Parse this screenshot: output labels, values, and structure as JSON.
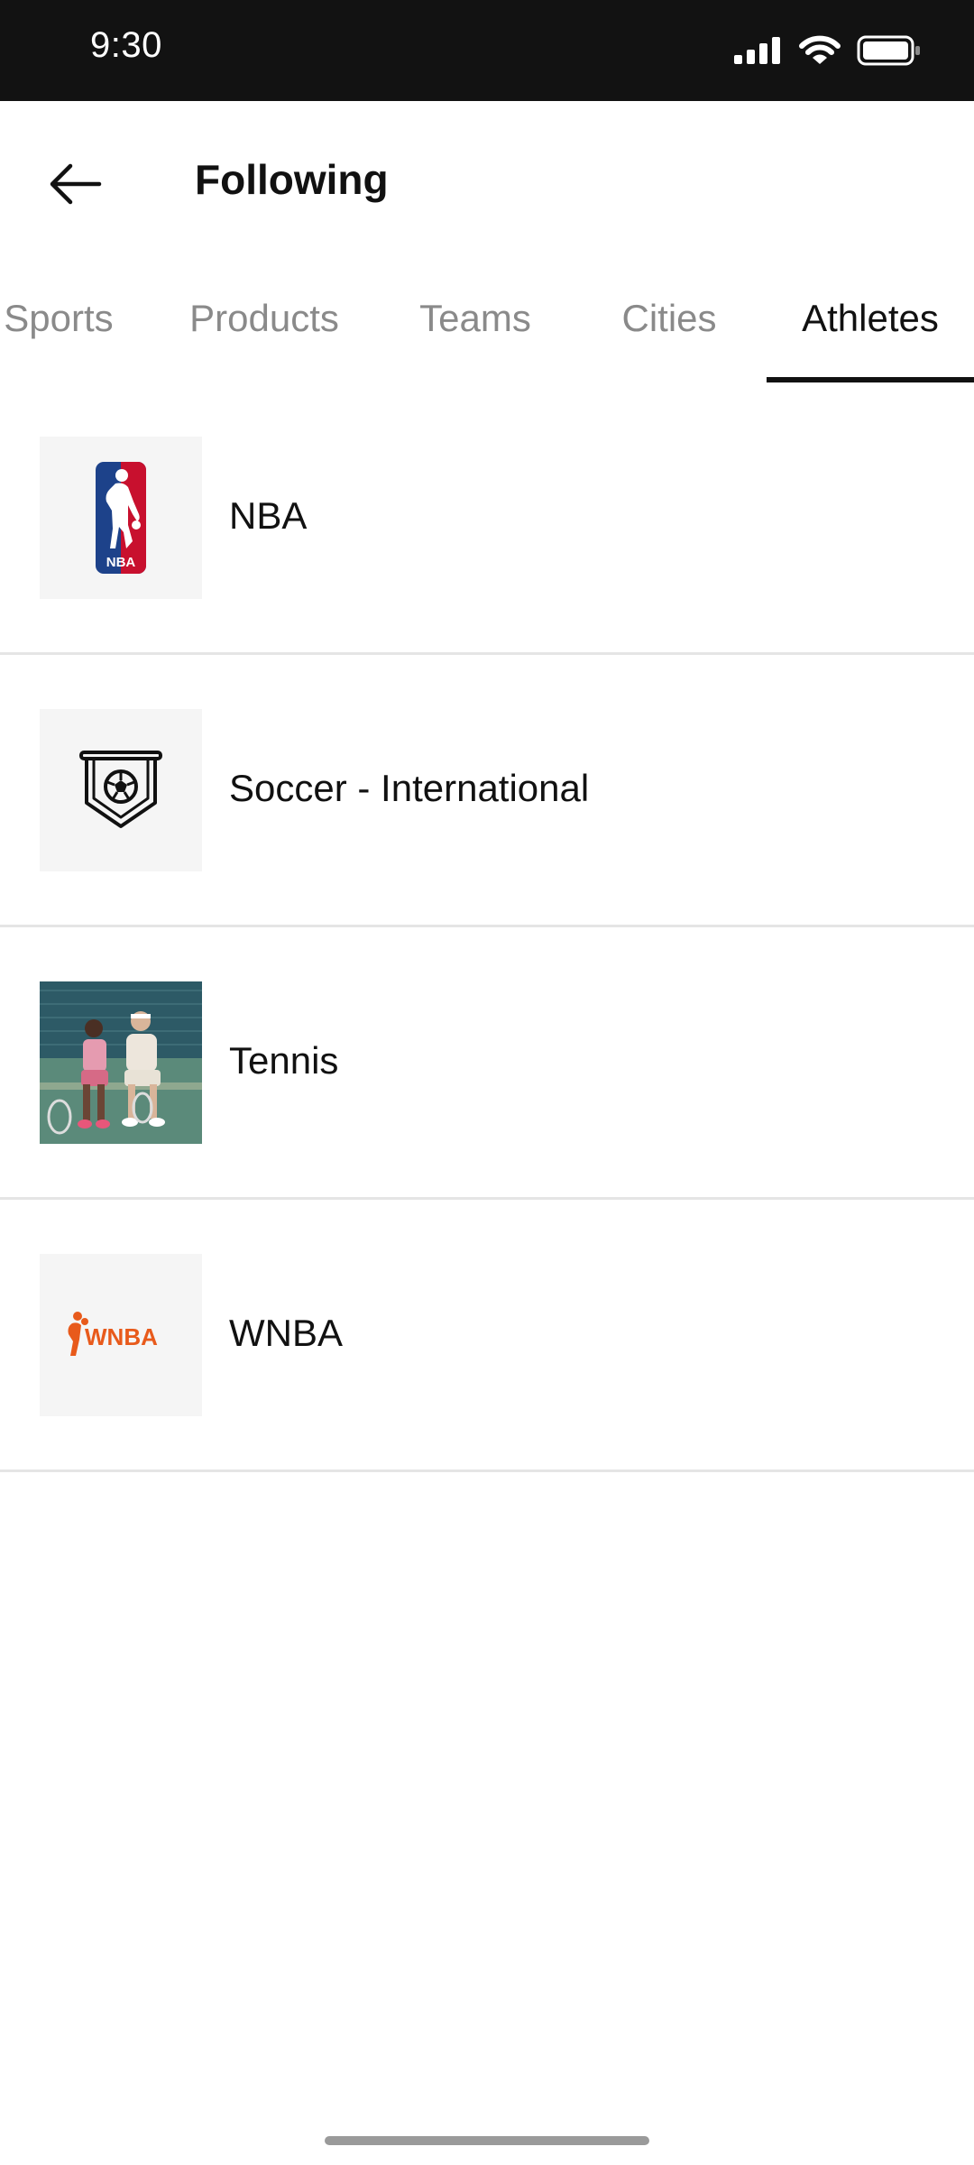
{
  "status_bar": {
    "time": "9:30"
  },
  "header": {
    "title": "Following"
  },
  "tabs": [
    {
      "label": "Sports",
      "active": false
    },
    {
      "label": "Products",
      "active": false
    },
    {
      "label": "Teams",
      "active": false
    },
    {
      "label": "Cities",
      "active": false
    },
    {
      "label": "Athletes",
      "active": true
    }
  ],
  "items": [
    {
      "label": "NBA",
      "icon": "nba-logo-icon"
    },
    {
      "label": "Soccer - International",
      "icon": "soccer-crest-icon"
    },
    {
      "label": "Tennis",
      "icon": "tennis-photo"
    },
    {
      "label": "WNBA",
      "icon": "wnba-logo-icon"
    }
  ],
  "colors": {
    "nba_blue": "#1d428a",
    "nba_red": "#c8102e",
    "wnba_orange": "#e85a1b",
    "active_tab": "#111111",
    "inactive_tab": "#8a8a8a"
  },
  "logos": {
    "nba_text": "NBA",
    "wnba_text": "WNBA"
  }
}
